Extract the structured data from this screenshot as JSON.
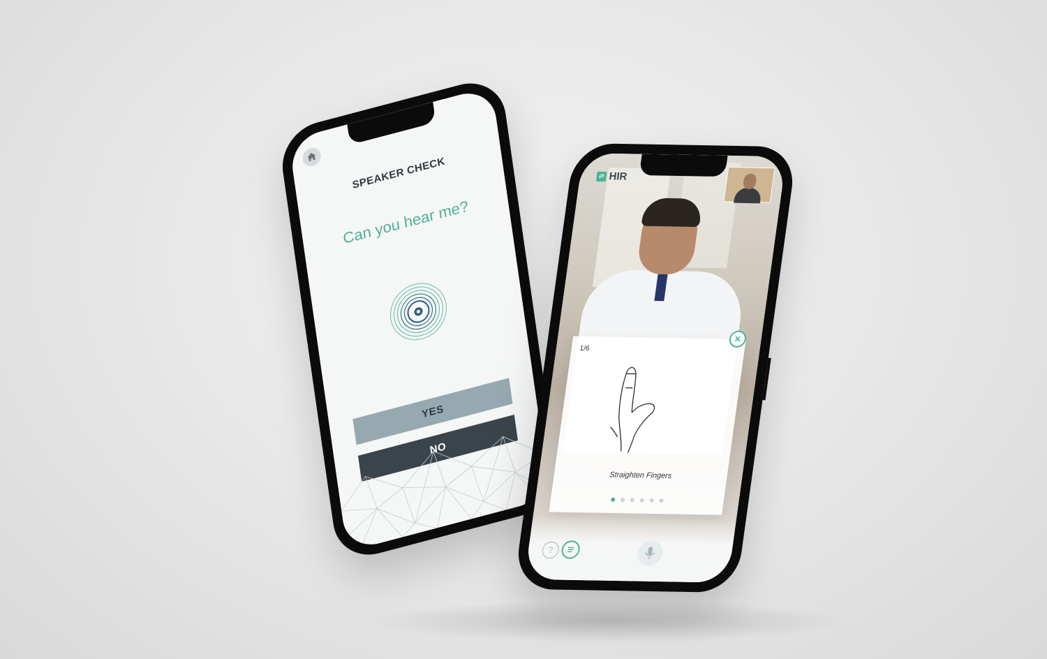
{
  "left_phone": {
    "home_icon": "home-icon",
    "title": "SPEAKER CHECK",
    "question": "Can you hear me?",
    "speaker_icon": "speaker-icon",
    "yes_label": "YES",
    "no_label": "NO"
  },
  "right_phone": {
    "logo_text": "HIR",
    "self_view_icon": "camera-self-view",
    "close_icon": "close-icon",
    "card": {
      "page": "1/6",
      "caption": "Straighten Fingers",
      "total_dots": 6,
      "active_dot": 0
    },
    "help_icon": "question-icon",
    "help_glyph": "?",
    "transcript_icon": "transcript-icon",
    "mic_icon": "microphone-icon"
  },
  "colors": {
    "accent": "#4fb196",
    "dark_button": "#3a444a",
    "light_button": "#96a8b0"
  }
}
